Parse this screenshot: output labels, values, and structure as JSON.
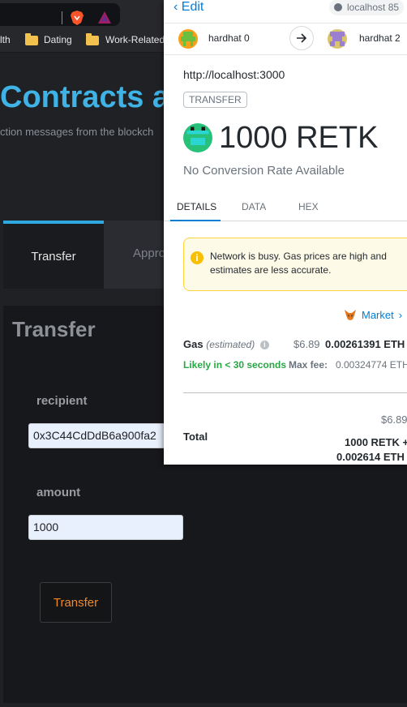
{
  "bookmarks": [
    {
      "label": "lth",
      "folder": false
    },
    {
      "label": "Dating",
      "folder": true
    },
    {
      "label": "Work-Related",
      "folder": true
    }
  ],
  "page": {
    "hero_title": "Contracts a",
    "hero_subtitle": "ction messages from the blockch",
    "tabs": [
      "Transfer",
      "Appro"
    ],
    "panel_title": "Transfer",
    "recipient_label": "recipient",
    "recipient_value": "0x3C44CdDdB6a900fa2",
    "amount_label": "amount",
    "amount_value": "1000",
    "transfer_button": "Transfer"
  },
  "metamask": {
    "edit": "Edit",
    "origin_pill": "localhost 85",
    "from_account": "hardhat 0",
    "to_account": "hardhat 2",
    "site_origin": "http://localhost:3000",
    "tx_type": "TRANSFER",
    "amount": "1000 RETK",
    "conversion": "No Conversion Rate Available",
    "tabs": {
      "details": "DETAILS",
      "data": "DATA",
      "hex": "HEX"
    },
    "warning": "Network is busy. Gas prices are high and estimates are less accurate.",
    "market": "Market",
    "gas_label": "Gas",
    "gas_estimated": "(estimated)",
    "gas_fiat": "$6.89",
    "gas_eth": "0.00261391 ETH",
    "likely": "Likely in < 30 seconds",
    "max_fee_label": "Max fee:",
    "max_fee_value": "0.00324774 ETH",
    "total_label": "Total",
    "total_fiat": "$6.89",
    "total_line1": "1000 RETK +",
    "total_line2": "0.002614 ETH"
  },
  "colors": {
    "accent": "#3fb2e6",
    "tab_accent": "#2ea8de",
    "button_text": "#f0892b",
    "metamask_blue": "#037dd6",
    "likely_green": "#28a745"
  },
  "icons": [
    "brave-lion-icon",
    "bat-triangle-icon",
    "folder-icon",
    "chevron-left-icon",
    "arrow-right-icon",
    "identicon",
    "warning-icon",
    "fox-icon",
    "info-icon"
  ]
}
